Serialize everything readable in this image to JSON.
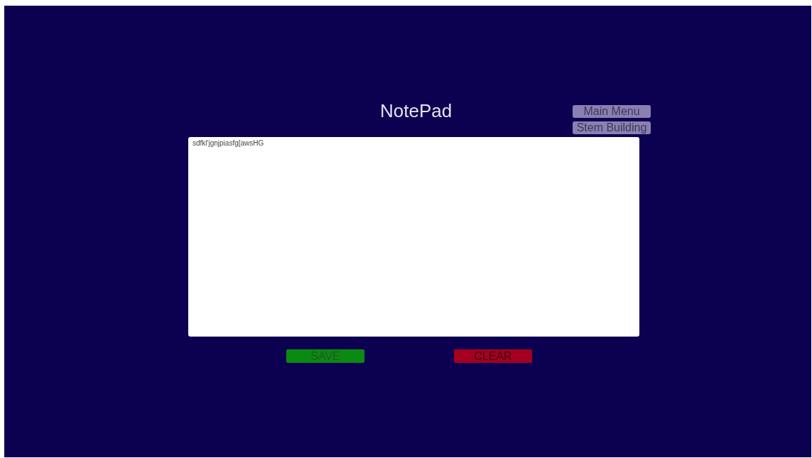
{
  "title": "NotePad",
  "nav_buttons": [
    {
      "label": "Main Menu"
    },
    {
      "label": "Stem Building"
    }
  ],
  "notepad": {
    "value": "sdfkl'jgnjpiasfg[awsHG"
  },
  "actions": [
    {
      "label": "SAVE",
      "kind": "save"
    },
    {
      "label": "CLEAR",
      "kind": "clear"
    }
  ]
}
